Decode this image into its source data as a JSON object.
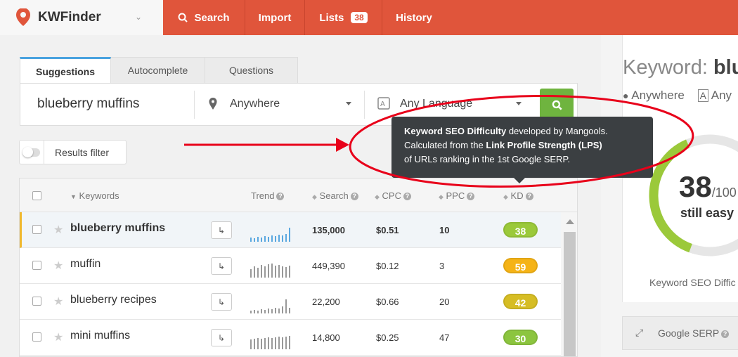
{
  "app": {
    "name": "KWFinder"
  },
  "nav": {
    "search": "Search",
    "import": "Import",
    "lists": "Lists",
    "lists_count": "38",
    "history": "History"
  },
  "tabs": [
    "Suggestions",
    "Autocomplete",
    "Questions"
  ],
  "search": {
    "keyword": "blueberry muffins",
    "location": "Anywhere",
    "language": "Any Language"
  },
  "filter": {
    "label": "Results filter"
  },
  "table": {
    "headers": {
      "keywords": "Keywords",
      "trend": "Trend",
      "search": "Search",
      "cpc": "CPC",
      "ppc": "PPC",
      "kd": "KD"
    },
    "rows": [
      {
        "keyword": "blueberry muffins",
        "search": "135,000",
        "cpc": "$0.51",
        "ppc": "10",
        "kd": "38",
        "kd_color": "#9bc93a",
        "trend": [
          0.3,
          0.25,
          0.35,
          0.3,
          0.4,
          0.35,
          0.45,
          0.4,
          0.5,
          0.45,
          0.55,
          1.0
        ],
        "trend_color": "#5aa8e0"
      },
      {
        "keyword": "muffin",
        "search": "449,390",
        "cpc": "$0.12",
        "ppc": "3",
        "kd": "59",
        "kd_color": "#f5b316",
        "trend": [
          0.6,
          0.8,
          0.7,
          0.9,
          0.8,
          0.95,
          1.0,
          0.85,
          0.9,
          0.8,
          0.75,
          0.85
        ],
        "trend_color": "#999999"
      },
      {
        "keyword": "blueberry recipes",
        "search": "22,200",
        "cpc": "$0.66",
        "ppc": "20",
        "kd": "42",
        "kd_color": "#d6bd24",
        "trend": [
          0.2,
          0.25,
          0.2,
          0.3,
          0.25,
          0.35,
          0.3,
          0.4,
          0.35,
          0.5,
          1.0,
          0.4
        ],
        "trend_color": "#999999"
      },
      {
        "keyword": "mini muffins",
        "search": "14,800",
        "cpc": "$0.25",
        "ppc": "47",
        "kd": "30",
        "kd_color": "#8cc53f",
        "trend": [
          0.7,
          0.75,
          0.8,
          0.75,
          0.8,
          0.85,
          0.8,
          0.85,
          0.9,
          0.85,
          0.9,
          0.95
        ],
        "trend_color": "#999999"
      }
    ]
  },
  "tooltip": {
    "bold1": "Keyword SEO Difficulty",
    "text1": " developed by Mangools.",
    "text2": "Calculated from the ",
    "bold2": "Link Profile Strength (LPS)",
    "text3": "of URLs ranking in the 1st Google SERP."
  },
  "right": {
    "title_prefix": "Keyword: ",
    "title_keyword": "blu",
    "location": "Anywhere",
    "language": "Any",
    "score": "38",
    "score_max": "/100",
    "difficulty_word": "still easy",
    "kd_fraction": 0.38,
    "kd_label": "Keyword SEO Diffic",
    "serp_label": "Google SERP"
  },
  "colors": {
    "brand": "#e0553b",
    "accent_green": "#6fb43f",
    "annotation": "#e8001a"
  }
}
